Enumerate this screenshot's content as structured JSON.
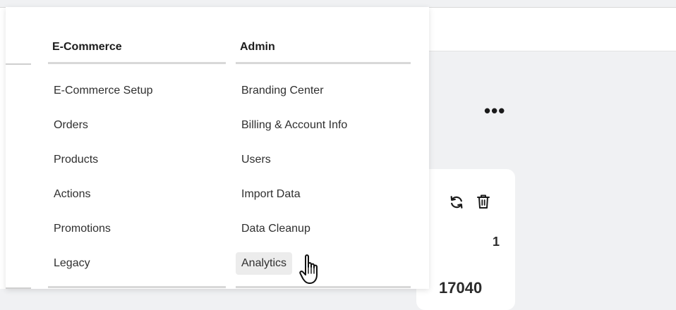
{
  "menu": {
    "columns": [
      {
        "header": "E-Commerce",
        "items": [
          "E-Commerce Setup",
          "Orders",
          "Products",
          "Actions",
          "Promotions",
          "Legacy"
        ]
      },
      {
        "header": "Admin",
        "items": [
          "Branding Center",
          "Billing & Account Info",
          "Users",
          "Import Data",
          "Data Cleanup",
          "Analytics"
        ],
        "hovered_index": 5
      }
    ]
  },
  "background": {
    "more_label": "•••",
    "card_values": [
      "1",
      "17040"
    ]
  },
  "icons": {
    "more": "more-horizontal-icon",
    "refresh": "refresh-icon",
    "delete": "trash-icon",
    "cursor": "hand-pointer-cursor"
  }
}
